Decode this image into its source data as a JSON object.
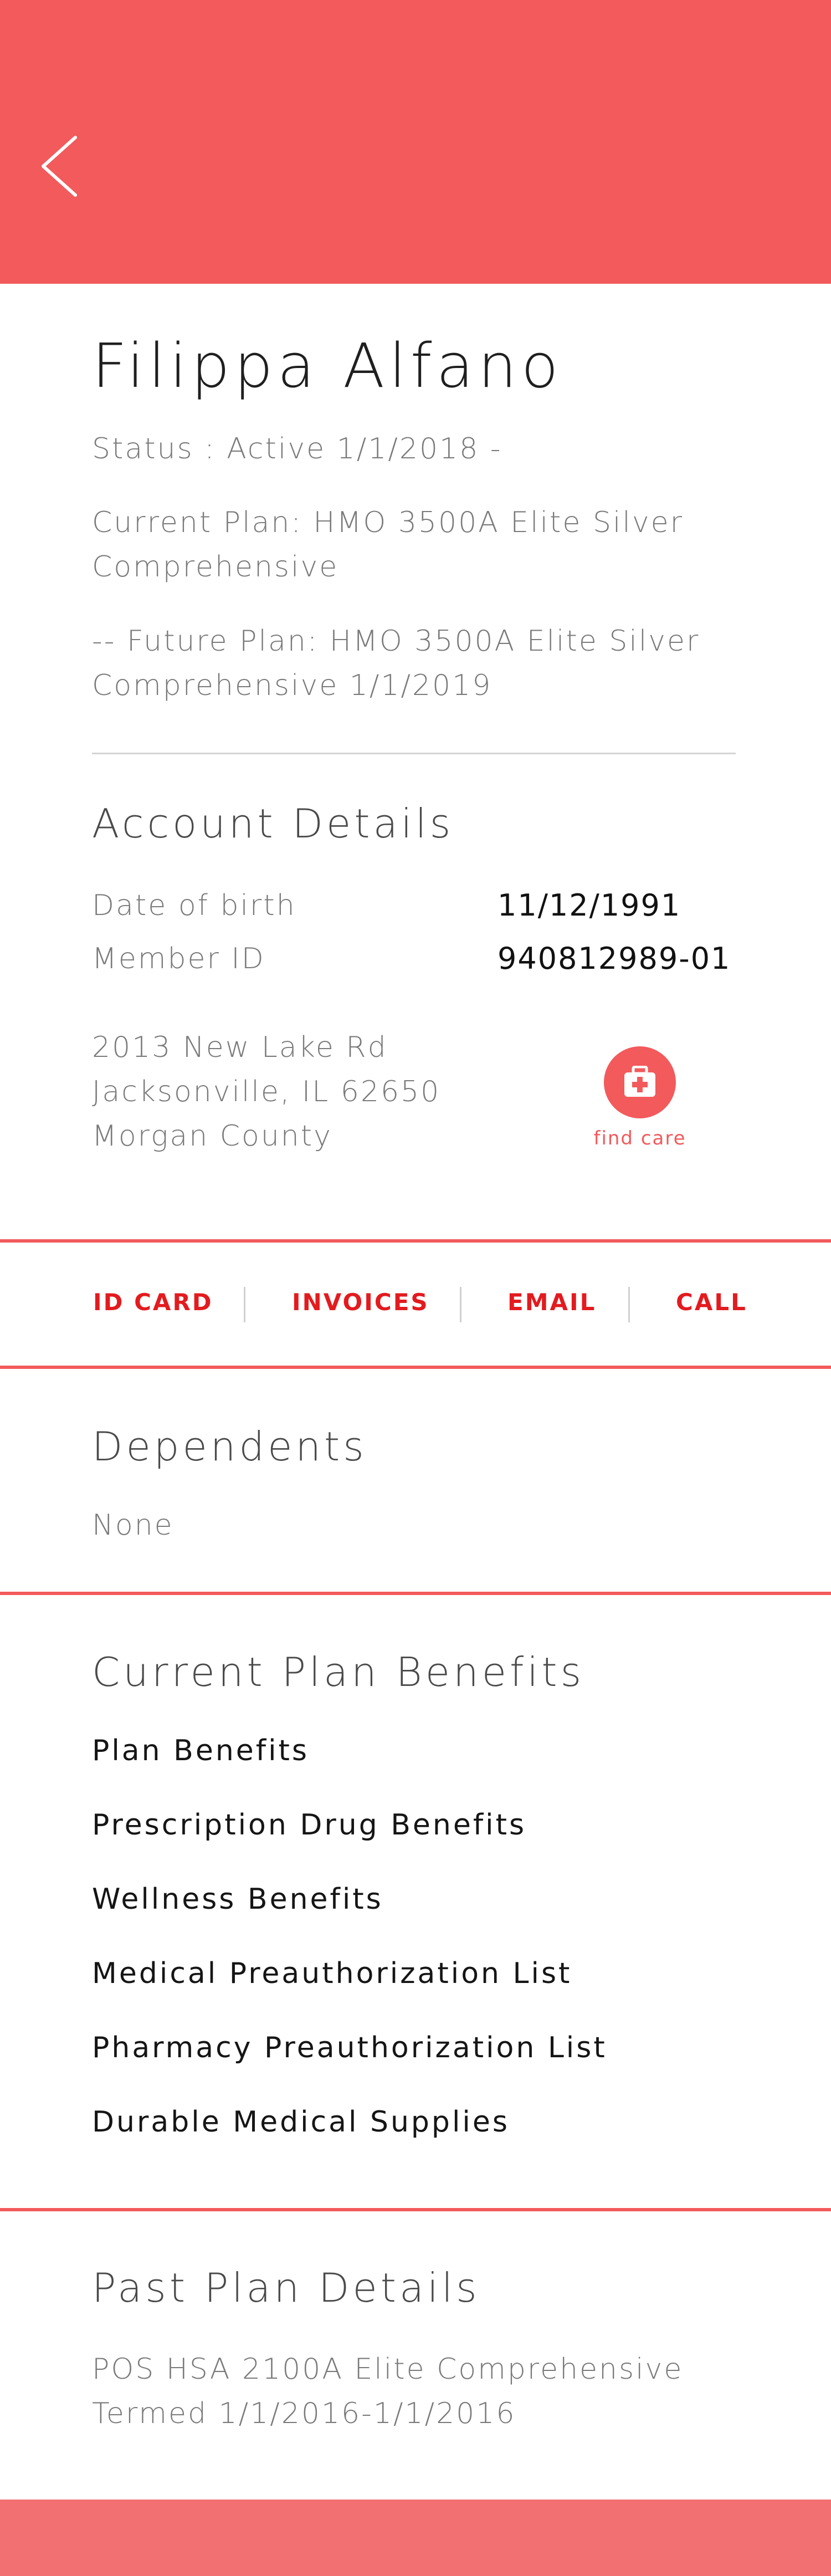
{
  "header": {
    "back_icon": "chevron-left-icon",
    "background_color": "#f25a5c"
  },
  "member": {
    "name": "Filippa Alfano",
    "status": "Status : Active 1/1/2018 -",
    "current_plan": "Current Plan: HMO 3500A Elite Silver Comprehensive",
    "future_plan": "-- Future Plan: HMO 3500A Elite Silver Comprehensive 1/1/2019"
  },
  "account_details": {
    "title": "Account Details",
    "dob_label": "Date of birth",
    "dob_value": "11/12/1991",
    "member_id_label": "Member ID",
    "member_id_value": "940812989-01",
    "address_line1": "2013 New Lake Rd",
    "address_line2": "Jacksonville, IL 62650",
    "address_line3": "Morgan County",
    "find_care_label": "find care",
    "find_care_icon": "first-aid-kit-icon"
  },
  "actions": {
    "id_card": "ID CARD",
    "invoices": "INVOICES",
    "email": "EMAIL",
    "call": "CALL",
    "accent_color": "#e31b1f"
  },
  "dependents": {
    "title": "Dependents",
    "value": "None"
  },
  "current_plan_benefits": {
    "title": "Current Plan Benefits",
    "items": [
      "Plan Benefits",
      "Prescription Drug Benefits",
      "Wellness Benefits",
      "Medical Preauthorization List",
      "Pharmacy Preauthorization List",
      "Durable Medical Supplies"
    ]
  },
  "past_plan": {
    "title": "Past Plan Details",
    "line1": "POS HSA 2100A Elite Comprehensive",
    "line2": "Termed 1/1/2016-1/1/2016"
  }
}
